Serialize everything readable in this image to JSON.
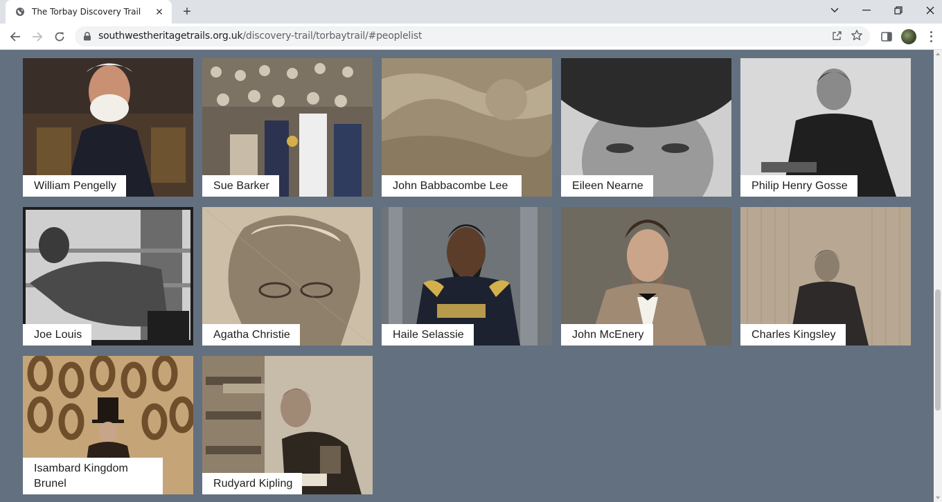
{
  "browser": {
    "tab_title": "The Torbay Discovery Trail",
    "url_host": "southwestheritagetrails.org.uk",
    "url_path": "/discovery-trail/torbaytrail/#peoplelist"
  },
  "people": [
    {
      "name": "William Pengelly",
      "colors": [
        "#3a2e28",
        "#7a5b3b",
        "#1d1f2a"
      ]
    },
    {
      "name": "Sue Barker",
      "colors": [
        "#6b6155",
        "#c9c2b5",
        "#3a4868"
      ]
    },
    {
      "name": "John Babbacombe Lee",
      "colors": [
        "#9d8d72",
        "#b9ab8f",
        "#7e7057"
      ]
    },
    {
      "name": "Eileen Nearne",
      "colors": [
        "#2b2b2b",
        "#9a9a9a",
        "#cfcfcf"
      ]
    },
    {
      "name": "Philip Henry Gosse",
      "colors": [
        "#d9d9d9",
        "#6d6d6d",
        "#1f1f1f"
      ]
    },
    {
      "name": "Joe Louis",
      "colors": [
        "#cfcfcf",
        "#5a5a5a",
        "#1e1e1e"
      ]
    },
    {
      "name": "Agatha Christie",
      "colors": [
        "#cdbfa7",
        "#8f806b",
        "#5c5043"
      ]
    },
    {
      "name": "Haile Selassie",
      "colors": [
        "#6f7478",
        "#1d2230",
        "#b79a4b"
      ]
    },
    {
      "name": "John McEnery",
      "colors": [
        "#6e6a5f",
        "#caa58a",
        "#2a2320"
      ]
    },
    {
      "name": "Charles Kingsley",
      "colors": [
        "#b8a893",
        "#8c7e6c",
        "#2d2a29"
      ]
    },
    {
      "name": "Isambard Kingdom Brunel",
      "colors": [
        "#c5a577",
        "#6f4e2b",
        "#2b2118"
      ]
    },
    {
      "name": "Rudyard Kipling",
      "colors": [
        "#c7bca9",
        "#6d5f4e",
        "#2e2720"
      ]
    }
  ]
}
